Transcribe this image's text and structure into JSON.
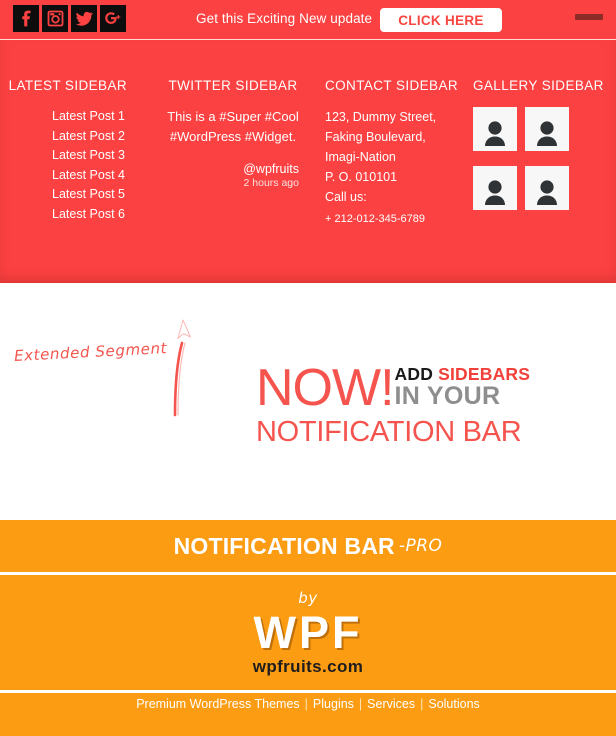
{
  "notification_bar": {
    "social_icons": [
      {
        "name": "facebook-icon",
        "label": "Facebook"
      },
      {
        "name": "instagram-icon",
        "label": "Instagram"
      },
      {
        "name": "twitter-icon",
        "label": "Twitter"
      },
      {
        "name": "google-plus-icon",
        "label": "Google Plus"
      }
    ],
    "message": "Get this Exciting New update",
    "cta_label": "CLICK HERE",
    "collapse_icon": "minus-bar-icon",
    "scroll_up_icon": "arrow-up-icon",
    "bar_color": "#fb4141",
    "cta_text_color": "#f9453f"
  },
  "sidebars": {
    "latest": {
      "title": "LATEST SIDEBAR",
      "posts": [
        "Latest Post 1",
        "Latest Post 2",
        "Latest Post 3",
        "Latest Post 4",
        "Latest Post 5",
        "Latest Post 6"
      ]
    },
    "twitter": {
      "title": "TWITTER SIDEBAR",
      "tweet": "This is a #Super #Cool #WordPress #Widget.",
      "handle": "@wpfruits",
      "time_ago": "2 hours ago"
    },
    "contact": {
      "title": "CONTACT SIDEBAR",
      "lines": [
        "123, Dummy Street,",
        "Faking Boulevard,",
        "Imagi-Nation",
        "P. O. 010101",
        "Call us:"
      ],
      "phone": "+ 212-012-345-6789"
    },
    "gallery": {
      "title": "GALLERY SIDEBAR",
      "items": [
        {
          "name": "gallery-thumb-1",
          "icon": "person-placeholder-icon"
        },
        {
          "name": "gallery-thumb-2",
          "icon": "person-placeholder-icon"
        },
        {
          "name": "gallery-thumb-3",
          "icon": "person-placeholder-icon"
        },
        {
          "name": "gallery-thumb-4",
          "icon": "person-placeholder-icon"
        }
      ]
    }
  },
  "annotation": {
    "text": "Extended Segment",
    "arrow_icon": "curved-arrow-up-icon",
    "color": "#f2564f"
  },
  "hero": {
    "now": "NOW!",
    "add": "ADD",
    "sidebars": "SIDEBARS",
    "in_your": "IN YOUR",
    "notification_bar": "NOTIFICATION BAR",
    "colors": {
      "red": "#f4544d",
      "bright_red": "#f2403a",
      "gray": "#8e8e8e",
      "black": "#1b1b1b"
    }
  },
  "pro_band": {
    "title": "NOTIFICATION BAR",
    "suffix": "-PRO",
    "background": "#fb9c13"
  },
  "brand": {
    "by": "by",
    "logo": "WPF",
    "url": "wpfruits.com"
  },
  "footer": {
    "links": [
      "Premium WordPress Themes",
      "Plugins",
      "Services",
      "Solutions"
    ],
    "separator": "|"
  }
}
